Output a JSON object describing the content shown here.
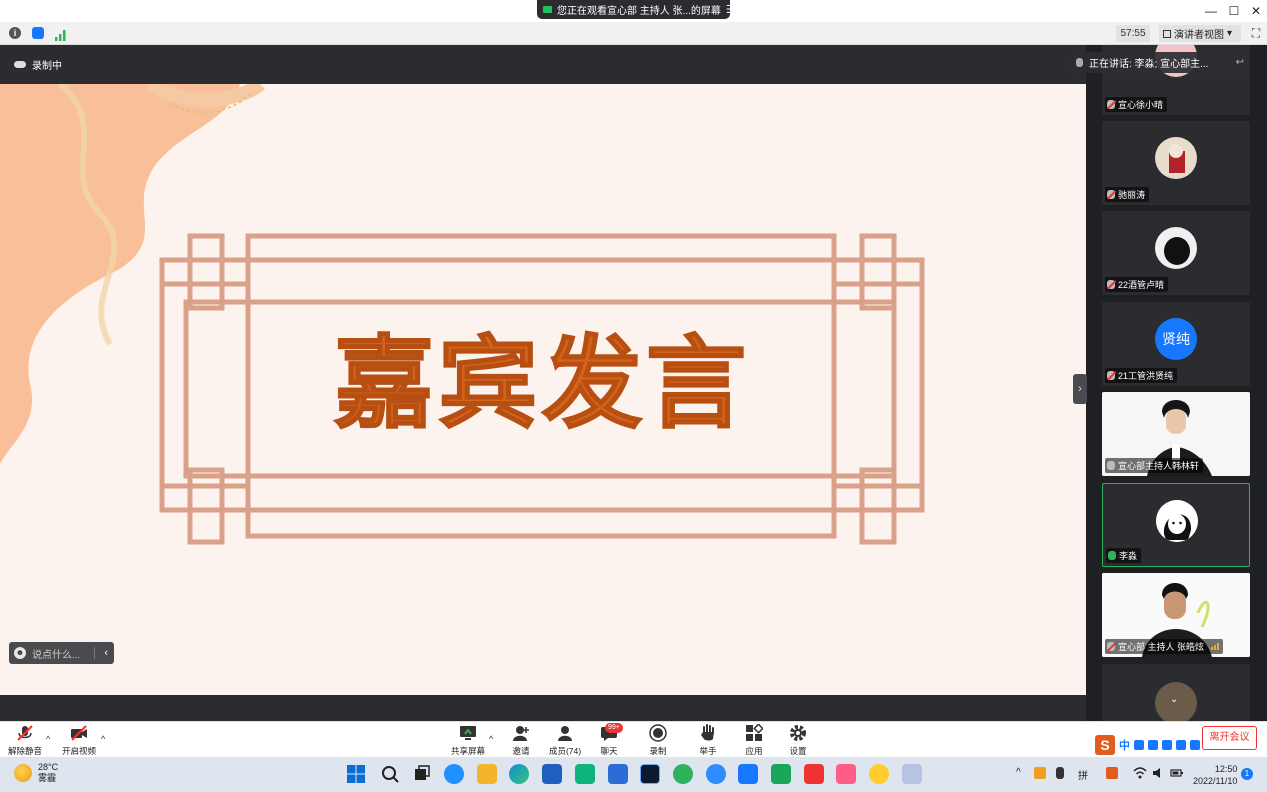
{
  "window": {
    "share_banner": "您正在观看宣心部 主持人 张...的屏幕",
    "menu_glyph": "☰",
    "minimize": "—",
    "maximize": "☐",
    "close": "✕"
  },
  "toolbar": {
    "info_glyph": "i",
    "timer": "57:55",
    "speaker_view": "演讲者视图",
    "speaker_view_caret": "▾",
    "fullscreen_glyph": "⛶"
  },
  "recording": {
    "label": "录制中"
  },
  "slide": {
    "title": "嘉宾发言"
  },
  "chat_input": {
    "placeholder": "说点什么...",
    "smile": "☻",
    "collapse": "‹"
  },
  "now_speaking": {
    "text": "正在讲话: 李淼; 宣心部主...",
    "arrow": "↩"
  },
  "side_handle": "›",
  "participants": [
    {
      "name": "宣心徐小晴",
      "mic": "off"
    },
    {
      "name": "驰丽涛",
      "mic": "off"
    },
    {
      "name": "22酒管卢晴",
      "mic": "off"
    },
    {
      "name": "21工管洪贤纯",
      "mic": "off",
      "avatar_text": "贤纯"
    },
    {
      "name": "宣心部主持人韩林轩",
      "mic": "muted-grey"
    },
    {
      "name": "李淼",
      "mic": "on"
    },
    {
      "name": "宣心部 主持人 张皓炫",
      "mic": "off"
    },
    {
      "name": "",
      "mic": ""
    }
  ],
  "controls": {
    "unmute": "解除静音",
    "start_video": "开启视频",
    "share_screen": "共享屏幕",
    "invite": "邀请",
    "members": "成员(74)",
    "chat": "聊天",
    "chat_badge": "99+",
    "record": "录制",
    "raise_hand": "举手",
    "apps": "应用",
    "settings": "设置",
    "leave": "离开会议",
    "caret": "^"
  },
  "ime": {
    "logo": "S",
    "lang": "中"
  },
  "taskbar": {
    "temperature": "28°C",
    "weather": "雾霾",
    "time": "12:50",
    "date": "2022/11/10",
    "notification_count": "1",
    "tray_caret": "^",
    "keyboard": "拼"
  },
  "colors": {
    "slide_bg": "#fdf3ee",
    "slide_title": "#d4641a",
    "frame": "#d9a08a",
    "accent_blue": "#1677ff",
    "active_green": "#2db35d",
    "leave_red": "#e33333"
  }
}
